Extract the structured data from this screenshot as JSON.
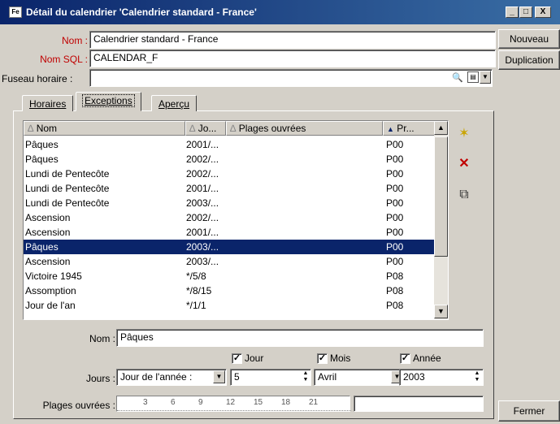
{
  "window": {
    "title": "Détail du calendrier 'Calendrier standard - France'",
    "icon_text": "Fe",
    "controls": {
      "minimize": "_",
      "maximize": "□",
      "close": "X"
    }
  },
  "form": {
    "nom_label": "Nom :",
    "nom_value": "Calendrier standard - France",
    "nomsql_label": "Nom SQL :",
    "nomsql_value": "CALENDAR_F",
    "fuseau_label": "Fuseau horaire :",
    "fuseau_value": ""
  },
  "buttons": {
    "nouveau": "Nouveau",
    "duplication": "Duplication",
    "fermer": "Fermer"
  },
  "tabs": [
    {
      "label": "Horaires"
    },
    {
      "label": "Exceptions"
    },
    {
      "label": "Aperçu"
    }
  ],
  "active_tab": "Exceptions",
  "table": {
    "headers": [
      {
        "label": "Nom",
        "sort": "∆"
      },
      {
        "label": "Jo...",
        "sort": "∆"
      },
      {
        "label": "Plages ouvrées",
        "sort": "∆"
      },
      {
        "label": "Pr...",
        "sort": "▲"
      }
    ],
    "rows": [
      {
        "nom": "Pâques",
        "jour": "2001/...",
        "plages": "",
        "pr": "P00"
      },
      {
        "nom": "Pâques",
        "jour": "2002/...",
        "plages": "",
        "pr": "P00"
      },
      {
        "nom": "Lundi de Pentecôte",
        "jour": "2002/...",
        "plages": "",
        "pr": "P00"
      },
      {
        "nom": "Lundi de Pentecôte",
        "jour": "2001/...",
        "plages": "",
        "pr": "P00"
      },
      {
        "nom": "Lundi de Pentecôte",
        "jour": "2003/...",
        "plages": "",
        "pr": "P00"
      },
      {
        "nom": "Ascension",
        "jour": "2002/...",
        "plages": "",
        "pr": "P00"
      },
      {
        "nom": "Ascension",
        "jour": "2001/...",
        "plages": "",
        "pr": "P00"
      },
      {
        "nom": "Pâques",
        "jour": "2003/...",
        "plages": "",
        "pr": "P00",
        "selected": true
      },
      {
        "nom": "Ascension",
        "jour": "2003/...",
        "plages": "",
        "pr": "P00"
      },
      {
        "nom": "Victoire 1945",
        "jour": "*/5/8",
        "plages": "",
        "pr": "P08"
      },
      {
        "nom": "Assomption",
        "jour": "*/8/15",
        "plages": "",
        "pr": "P08"
      },
      {
        "nom": "Jour de l'an",
        "jour": "*/1/1",
        "plages": "",
        "pr": "P08"
      }
    ]
  },
  "toolbar_icons": [
    "new-record-icon",
    "delete-record-icon",
    "duplicate-record-icon"
  ],
  "detail": {
    "nom_label": "Nom :",
    "nom_value": "Pâques",
    "jour_check": "Jour",
    "mois_check": "Mois",
    "annee_check": "Année",
    "jours_label": "Jours :",
    "jours_type": "Jour de l'année :",
    "jour_value": "5",
    "mois_value": "Avril",
    "annee_value": "2003",
    "plages_label": "Plages ouvrées :",
    "ruler_ticks": [
      "3",
      "6",
      "9",
      "12",
      "15",
      "18",
      "21"
    ]
  },
  "colors": {
    "titlebar": "#0a246a",
    "selection": "#0a246a",
    "required_label": "#c00000",
    "face": "#d4d0c8"
  }
}
